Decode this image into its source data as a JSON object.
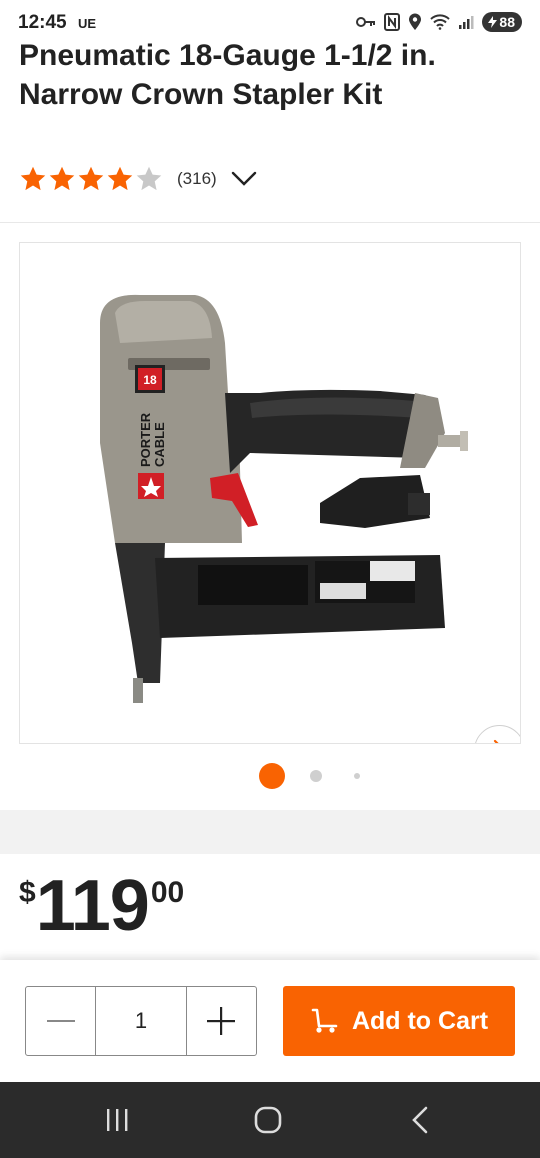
{
  "status_bar": {
    "time": "12:45",
    "carrier": "UE",
    "battery": "88",
    "icons": [
      "key-icon",
      "nfc-icon",
      "location-icon",
      "wifi-icon",
      "signal-icon"
    ]
  },
  "product": {
    "title": "Pneumatic 18-Gauge 1-1/2 in. Narrow Crown Stapler Kit",
    "rating": 4,
    "rating_max": 5,
    "review_count": "(316)",
    "image_alt": "PORTER CABLE stapler"
  },
  "gallery": {
    "image_count": 3,
    "active_index": 0
  },
  "price": {
    "symbol": "$",
    "whole": "119",
    "cents": "00"
  },
  "cart": {
    "quantity": "1",
    "add_label": "Add to Cart"
  },
  "colors": {
    "accent": "#f96302",
    "star_filled": "#f96302",
    "star_empty": "#c8c8c8",
    "nav_bar": "#2b2b2b"
  }
}
